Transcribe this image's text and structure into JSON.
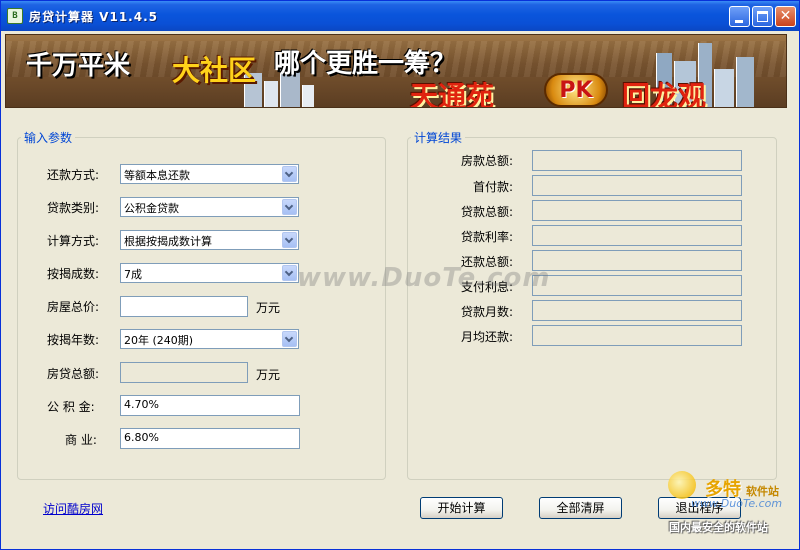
{
  "window": {
    "title": "房贷计算器 V11.4.5",
    "app_icon_glyph": "B"
  },
  "banner": {
    "text1": "千万平米",
    "text2": "大社区",
    "text3": "哪个更胜一筹？",
    "text4": "天通苑",
    "pk": "PK",
    "text5": "回龙观"
  },
  "input_group": {
    "title": "输入参数",
    "repay_method": {
      "label": "还款方式:",
      "value": "等额本息还款"
    },
    "loan_type": {
      "label": "贷款类别:",
      "value": "公积金贷款"
    },
    "calc_method": {
      "label": "计算方式:",
      "value": "根据按揭成数计算"
    },
    "mortgage_ratio": {
      "label": "按揭成数:",
      "value": "7成"
    },
    "house_price": {
      "label": "房屋总价:",
      "value": "",
      "unit": "万元"
    },
    "mortgage_years": {
      "label": "按揭年数:",
      "value": "20年 (240期)"
    },
    "loan_total": {
      "label": "房贷总额:",
      "value": "",
      "unit": "万元"
    },
    "fund_rate": {
      "label": "公 积 金:",
      "value": "4.70%"
    },
    "commercial_rate": {
      "label": "商  业:",
      "value": "6.80%"
    }
  },
  "result_group": {
    "title": "计算结果",
    "labels": [
      "房款总额:",
      "首付款:",
      "贷款总额:",
      "贷款利率:",
      "还款总额:",
      "支付利息:",
      "贷款月数:",
      "月均还款:"
    ]
  },
  "footer": {
    "link": "访问酷房网",
    "calc_button": "开始计算",
    "clear_button": "全部清屏",
    "exit_button": "退出程序"
  },
  "watermark": {
    "center": "www.DuoTe.com",
    "brand": "多特",
    "brand_suffix": "软件站",
    "url": "www.DuoTe.com",
    "slogan": "国内最安全的软件站"
  }
}
